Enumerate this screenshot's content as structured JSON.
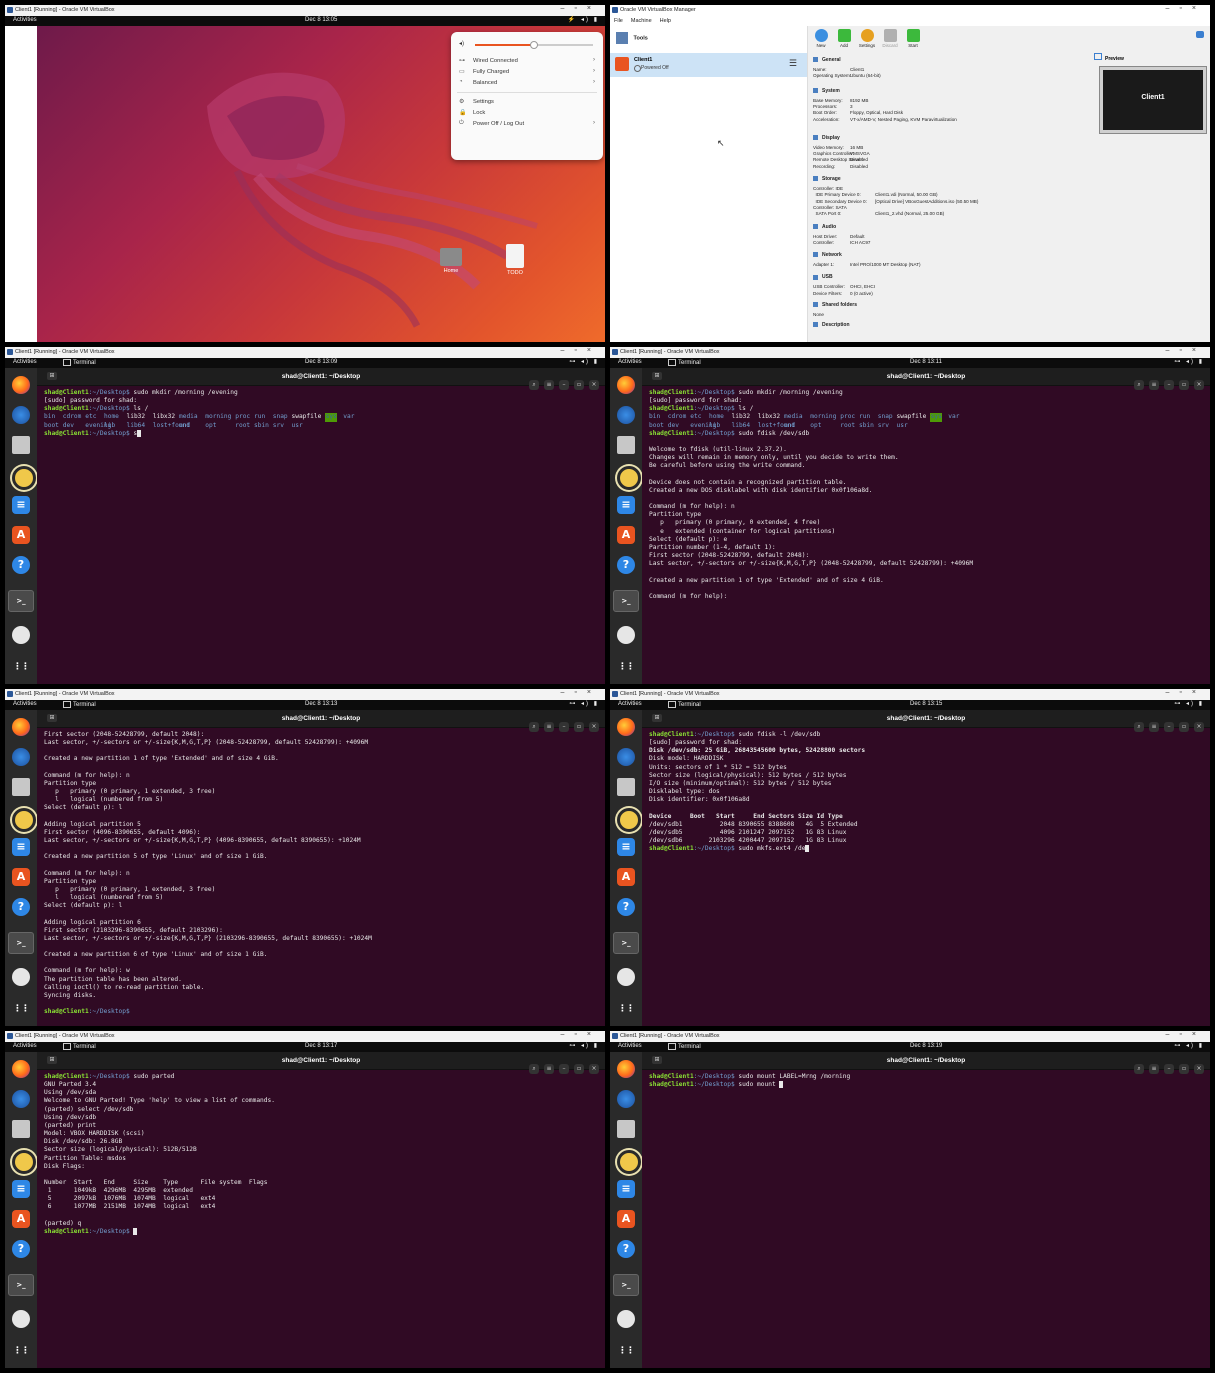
{
  "desktop": {
    "window_title": "Client1 [Running] - Oracle VM VirtualBox",
    "activities": "Activities",
    "clock": "Dec 8  13:05",
    "menu": {
      "items": [
        "Wired Connected",
        "Fully Charged",
        "Balanced",
        "Settings",
        "Lock",
        "Power Off / Log Out"
      ],
      "volume_level": 0.5
    },
    "icons": {
      "home": "Home",
      "todo": "TODO"
    }
  },
  "manager": {
    "window_title": "Oracle VM VirtualBox Manager",
    "menubar": [
      "File",
      "Machine",
      "Help"
    ],
    "tools_label": "Tools",
    "vm_name": "Client1",
    "vm_state": "Powered Off",
    "toolbar": [
      "New",
      "Add",
      "Settings",
      "Discard",
      "Start"
    ],
    "preview": {
      "title": "Preview",
      "label": "Client1"
    },
    "sections": [
      {
        "title": "General",
        "rows": [
          [
            "Name:",
            "Client1"
          ],
          [
            "Operating System:",
            "Ubuntu (64-bit)"
          ]
        ]
      },
      {
        "title": "System",
        "rows": [
          [
            "Base Memory:",
            "8192 MB"
          ],
          [
            "Processors:",
            "3"
          ],
          [
            "Boot Order:",
            "Floppy, Optical, Hard Disk"
          ],
          [
            "Acceleration:",
            "VT-x/AMD-V, Nested Paging, KVM Paravirtualization"
          ]
        ]
      },
      {
        "title": "Display",
        "rows": [
          [
            "Video Memory:",
            "16 MB"
          ],
          [
            "Graphics Controller:",
            "VMSVGA"
          ],
          [
            "Remote Desktop Server:",
            "Disabled"
          ],
          [
            "Recording:",
            "Disabled"
          ]
        ]
      },
      {
        "title": "Storage",
        "rows": [
          [
            "Controller: IDE",
            ""
          ],
          [
            "  IDE Primary Device 0:",
            "Client1.vdi (Normal, 50.00 GB)"
          ],
          [
            "  IDE Secondary Device 0:",
            "[Optical Drive] VBoxGuestAdditions.iso (50.50 MB)"
          ],
          [
            "Controller: SATA",
            ""
          ],
          [
            "  SATA Port 0:",
            "Client1_2.vhd (Normal, 25.00 GB)"
          ]
        ]
      },
      {
        "title": "Audio",
        "rows": [
          [
            "Host Driver:",
            "Default"
          ],
          [
            "Controller:",
            "ICH AC97"
          ]
        ]
      },
      {
        "title": "Network",
        "rows": [
          [
            "Adapter 1:",
            "Intel PRO/1000 MT Desktop (NAT)"
          ]
        ]
      },
      {
        "title": "USB",
        "rows": [
          [
            "USB Controller:",
            "OHCI, EHCI"
          ],
          [
            "Device Filters:",
            "0 (0 active)"
          ]
        ]
      },
      {
        "title": "Shared folders",
        "rows": [
          [
            "None",
            ""
          ]
        ]
      },
      {
        "title": "Description",
        "rows": []
      }
    ]
  },
  "terminals": [
    {
      "window_title": "Client1 [Running] - Oracle VM VirtualBox",
      "clock": "Dec 8  13:09",
      "app": "Terminal",
      "title": "shad@Client1: ~/Desktop",
      "prompt_user": "shad@Client1",
      "prompt_path": ":~/Desktop$",
      "lines": [
        {
          "t": "prompt",
          "cmd": " sudo mkdir /morning /evening"
        },
        {
          "t": "text",
          "s": "[sudo] password for shad:"
        },
        {
          "t": "prompt",
          "cmd": " ls /"
        },
        {
          "t": "ls",
          "cols": [
            [
              "bin",
              "dir"
            ],
            [
              "cdrom",
              "dir"
            ],
            [
              "etc",
              "dir"
            ],
            [
              "home",
              "dir"
            ],
            [
              "lib32",
              ""
            ],
            [
              "libx32",
              ""
            ],
            [
              "media",
              "dir"
            ],
            [
              "morning",
              "dir"
            ],
            [
              "proc",
              "dir"
            ],
            [
              "run",
              "dir"
            ],
            [
              "snap",
              "dir"
            ],
            [
              "swapfile",
              ""
            ],
            [
              "sys",
              "tmp"
            ],
            [
              "var",
              "dir"
            ]
          ]
        },
        {
          "t": "ls",
          "cols": [
            [
              "boot",
              "dir"
            ],
            [
              "dev",
              "dir"
            ],
            [
              "evening",
              "dir"
            ],
            [
              "lib",
              "dir"
            ],
            [
              "lib64",
              "dir"
            ],
            [
              "lost+found",
              "dir"
            ],
            [
              "mnt",
              "dir"
            ],
            [
              "opt",
              "dir"
            ],
            [
              "root",
              "dir"
            ],
            [
              "sbin",
              "dir"
            ],
            [
              "srv",
              "dir"
            ],
            [
              "usr",
              "dir"
            ]
          ]
        },
        {
          "t": "prompt",
          "cmd": " s",
          "cursor": true
        }
      ]
    },
    {
      "window_title": "Client1 [Running] - Oracle VM VirtualBox",
      "clock": "Dec 8  13:11",
      "app": "Terminal",
      "title": "shad@Client1: ~/Desktop",
      "prompt_user": "shad@Client1",
      "prompt_path": ":~/Desktop$",
      "lines": [
        {
          "t": "prompt",
          "cmd": " sudo mkdir /morning /evening"
        },
        {
          "t": "text",
          "s": "[sudo] password for shad:"
        },
        {
          "t": "prompt",
          "cmd": " ls /"
        },
        {
          "t": "ls",
          "cols": [
            [
              "bin",
              "dir"
            ],
            [
              "cdrom",
              "dir"
            ],
            [
              "etc",
              "dir"
            ],
            [
              "home",
              "dir"
            ],
            [
              "lib32",
              ""
            ],
            [
              "libx32",
              ""
            ],
            [
              "media",
              "dir"
            ],
            [
              "morning",
              "dir"
            ],
            [
              "proc",
              "dir"
            ],
            [
              "run",
              "dir"
            ],
            [
              "snap",
              "dir"
            ],
            [
              "swapfile",
              ""
            ],
            [
              "sys",
              "tmp"
            ],
            [
              "var",
              "dir"
            ]
          ]
        },
        {
          "t": "ls",
          "cols": [
            [
              "boot",
              "dir"
            ],
            [
              "dev",
              "dir"
            ],
            [
              "evening",
              "dir"
            ],
            [
              "lib",
              "dir"
            ],
            [
              "lib64",
              "dir"
            ],
            [
              "lost+found",
              "dir"
            ],
            [
              "mnt",
              "dir"
            ],
            [
              "opt",
              "dir"
            ],
            [
              "root",
              "dir"
            ],
            [
              "sbin",
              "dir"
            ],
            [
              "srv",
              "dir"
            ],
            [
              "usr",
              "dir"
            ]
          ]
        },
        {
          "t": "prompt",
          "cmd": " sudo fdisk /dev/sdb"
        },
        {
          "t": "text",
          "s": ""
        },
        {
          "t": "text",
          "s": "Welcome to fdisk (util-linux 2.37.2)."
        },
        {
          "t": "text",
          "s": "Changes will remain in memory only, until you decide to write them."
        },
        {
          "t": "text",
          "s": "Be careful before using the write command."
        },
        {
          "t": "text",
          "s": ""
        },
        {
          "t": "text",
          "s": "Device does not contain a recognized partition table."
        },
        {
          "t": "text",
          "s": "Created a new DOS disklabel with disk identifier 0x0f106a8d."
        },
        {
          "t": "text",
          "s": ""
        },
        {
          "t": "text",
          "s": "Command (m for help): n"
        },
        {
          "t": "text",
          "s": "Partition type"
        },
        {
          "t": "text",
          "s": "   p   primary (0 primary, 0 extended, 4 free)"
        },
        {
          "t": "text",
          "s": "   e   extended (container for logical partitions)"
        },
        {
          "t": "text",
          "s": "Select (default p): e"
        },
        {
          "t": "text",
          "s": "Partition number (1-4, default 1):"
        },
        {
          "t": "text",
          "s": "First sector (2048-52428799, default 2048):"
        },
        {
          "t": "text",
          "s": "Last sector, +/-sectors or +/-size{K,M,G,T,P} (2048-52428799, default 52428799): +4096M"
        },
        {
          "t": "text",
          "s": ""
        },
        {
          "t": "text",
          "s": "Created a new partition 1 of type 'Extended' and of size 4 GiB."
        },
        {
          "t": "text",
          "s": ""
        },
        {
          "t": "text",
          "s": "Command (m for help):"
        }
      ]
    },
    {
      "window_title": "Client1 [Running] - Oracle VM VirtualBox",
      "clock": "Dec 8  13:13",
      "app": "Terminal",
      "title": "shad@Client1: ~/Desktop",
      "prompt_user": "shad@Client1",
      "prompt_path": ":~/Desktop$",
      "lines": [
        {
          "t": "text",
          "s": "First sector (2048-52428799, default 2048):"
        },
        {
          "t": "text",
          "s": "Last sector, +/-sectors or +/-size{K,M,G,T,P} (2048-52428799, default 52428799): +4096M"
        },
        {
          "t": "text",
          "s": ""
        },
        {
          "t": "text",
          "s": "Created a new partition 1 of type 'Extended' and of size 4 GiB."
        },
        {
          "t": "text",
          "s": ""
        },
        {
          "t": "text",
          "s": "Command (m for help): n"
        },
        {
          "t": "text",
          "s": "Partition type"
        },
        {
          "t": "text",
          "s": "   p   primary (0 primary, 1 extended, 3 free)"
        },
        {
          "t": "text",
          "s": "   l   logical (numbered from 5)"
        },
        {
          "t": "text",
          "s": "Select (default p): l"
        },
        {
          "t": "text",
          "s": ""
        },
        {
          "t": "text",
          "s": "Adding logical partition 5"
        },
        {
          "t": "text",
          "s": "First sector (4096-8390655, default 4096):"
        },
        {
          "t": "text",
          "s": "Last sector, +/-sectors or +/-size{K,M,G,T,P} (4096-8390655, default 8390655): +1024M"
        },
        {
          "t": "text",
          "s": ""
        },
        {
          "t": "text",
          "s": "Created a new partition 5 of type 'Linux' and of size 1 GiB."
        },
        {
          "t": "text",
          "s": ""
        },
        {
          "t": "text",
          "s": "Command (m for help): n"
        },
        {
          "t": "text",
          "s": "Partition type"
        },
        {
          "t": "text",
          "s": "   p   primary (0 primary, 1 extended, 3 free)"
        },
        {
          "t": "text",
          "s": "   l   logical (numbered from 5)"
        },
        {
          "t": "text",
          "s": "Select (default p): l"
        },
        {
          "t": "text",
          "s": ""
        },
        {
          "t": "text",
          "s": "Adding logical partition 6"
        },
        {
          "t": "text",
          "s": "First sector (2103296-8390655, default 2103296):"
        },
        {
          "t": "text",
          "s": "Last sector, +/-sectors or +/-size{K,M,G,T,P} (2103296-8390655, default 8390655): +1024M"
        },
        {
          "t": "text",
          "s": ""
        },
        {
          "t": "text",
          "s": "Created a new partition 6 of type 'Linux' and of size 1 GiB."
        },
        {
          "t": "text",
          "s": ""
        },
        {
          "t": "text",
          "s": "Command (m for help): w"
        },
        {
          "t": "text",
          "s": "The partition table has been altered."
        },
        {
          "t": "text",
          "s": "Calling ioctl() to re-read partition table."
        },
        {
          "t": "text",
          "s": "Syncing disks."
        },
        {
          "t": "text",
          "s": ""
        },
        {
          "t": "prompt",
          "cmd": ""
        }
      ]
    },
    {
      "window_title": "Client1 [Running] - Oracle VM VirtualBox",
      "clock": "Dec 8  13:15",
      "app": "Terminal",
      "title": "shad@Client1: ~/Desktop",
      "prompt_user": "shad@Client1",
      "prompt_path": ":~/Desktop$",
      "lines": [
        {
          "t": "prompt",
          "cmd": " sudo fdisk -l /dev/sdb"
        },
        {
          "t": "text",
          "s": "[sudo] password for shad:"
        },
        {
          "t": "bold",
          "s": "Disk /dev/sdb: 25 GiB, 26843545600 bytes, 52428800 sectors"
        },
        {
          "t": "text",
          "s": "Disk model: HARDDISK"
        },
        {
          "t": "text",
          "s": "Units: sectors of 1 * 512 = 512 bytes"
        },
        {
          "t": "text",
          "s": "Sector size (logical/physical): 512 bytes / 512 bytes"
        },
        {
          "t": "text",
          "s": "I/O size (minimum/optimal): 512 bytes / 512 bytes"
        },
        {
          "t": "text",
          "s": "Disklabel type: dos"
        },
        {
          "t": "text",
          "s": "Disk identifier: 0x0f106a8d"
        },
        {
          "t": "text",
          "s": ""
        },
        {
          "t": "bold",
          "s": "Device     Boot   Start     End Sectors Size Id Type"
        },
        {
          "t": "text",
          "s": "/dev/sdb1          2048 8390655 8388608   4G  5 Extended"
        },
        {
          "t": "text",
          "s": "/dev/sdb5          4096 2101247 2097152   1G 83 Linux"
        },
        {
          "t": "text",
          "s": "/dev/sdb6       2103296 4200447 2097152   1G 83 Linux"
        },
        {
          "t": "prompt",
          "cmd": " sudo mkfs.ext4 /de",
          "cursor": true
        }
      ]
    },
    {
      "window_title": "Client1 [Running] - Oracle VM VirtualBox",
      "clock": "Dec 8  13:17",
      "app": "Terminal",
      "title": "shad@Client1: ~/Desktop",
      "prompt_user": "shad@Client1",
      "prompt_path": ":~/Desktop$",
      "lines": [
        {
          "t": "prompt",
          "cmd": " sudo parted"
        },
        {
          "t": "text",
          "s": "GNU Parted 3.4"
        },
        {
          "t": "text",
          "s": "Using /dev/sda"
        },
        {
          "t": "text",
          "s": "Welcome to GNU Parted! Type 'help' to view a list of commands."
        },
        {
          "t": "text",
          "s": "(parted) select /dev/sdb"
        },
        {
          "t": "text",
          "s": "Using /dev/sdb"
        },
        {
          "t": "text",
          "s": "(parted) print"
        },
        {
          "t": "text",
          "s": "Model: VBOX HARDDISK (scsi)"
        },
        {
          "t": "text",
          "s": "Disk /dev/sdb: 26.8GB"
        },
        {
          "t": "text",
          "s": "Sector size (logical/physical): 512B/512B"
        },
        {
          "t": "text",
          "s": "Partition Table: msdos"
        },
        {
          "t": "text",
          "s": "Disk Flags:"
        },
        {
          "t": "text",
          "s": ""
        },
        {
          "t": "text",
          "s": "Number  Start   End     Size    Type      File system  Flags"
        },
        {
          "t": "text",
          "s": " 1      1049kB  4296MB  4295MB  extended"
        },
        {
          "t": "text",
          "s": " 5      2097kB  1076MB  1074MB  logical   ext4"
        },
        {
          "t": "text",
          "s": " 6      1077MB  2151MB  1074MB  logical   ext4"
        },
        {
          "t": "text",
          "s": ""
        },
        {
          "t": "text",
          "s": "(parted) q"
        },
        {
          "t": "prompt",
          "cmd": " ",
          "cursor": true
        }
      ]
    },
    {
      "window_title": "Client1 [Running] - Oracle VM VirtualBox",
      "clock": "Dec 8  13:19",
      "app": "Terminal",
      "title": "shad@Client1: ~/Desktop",
      "prompt_user": "shad@Client1",
      "prompt_path": ":~/Desktop$",
      "lines": [
        {
          "t": "prompt",
          "cmd": " sudo mount LABEL=Mrng /morning"
        },
        {
          "t": "prompt",
          "cmd": " sudo mount ",
          "cursor": true
        }
      ]
    }
  ]
}
